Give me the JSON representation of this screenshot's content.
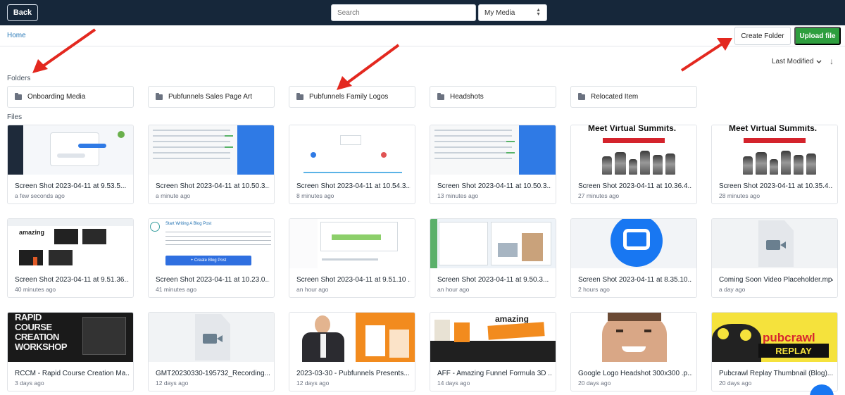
{
  "topbar": {
    "back_label": "Back",
    "search_placeholder": "Search",
    "media_select_value": "My Media"
  },
  "subheader": {
    "home_label": "Home",
    "create_folder_label": "Create Folder",
    "upload_label": "Upload file"
  },
  "sort": {
    "label": "Last Modified",
    "direction_icon": "↓"
  },
  "folders": {
    "label": "Folders",
    "items": [
      {
        "name": "Onboarding Media"
      },
      {
        "name": "Pubfunnels Sales Page Art"
      },
      {
        "name": "Pubfunnels Family Logos"
      },
      {
        "name": "Headshots"
      },
      {
        "name": "Relocated Item"
      }
    ]
  },
  "files": {
    "label": "Files",
    "items": [
      {
        "name": "Screen Shot 2023-04-11 at 9.53.5...",
        "time": "a few seconds ago"
      },
      {
        "name": "Screen Shot 2023-04-11 at 10.50.3...",
        "time": "a minute ago"
      },
      {
        "name": "Screen Shot 2023-04-11 at 10.54.3...",
        "time": "8 minutes ago"
      },
      {
        "name": "Screen Shot 2023-04-11 at 10.50.3...",
        "time": "13 minutes ago"
      },
      {
        "name": "Screen Shot 2023-04-11 at 10.36.4...",
        "time": "27 minutes ago"
      },
      {
        "name": "Screen Shot 2023-04-11 at 10.35.4...",
        "time": "28 minutes ago"
      },
      {
        "name": "Screen Shot 2023-04-11 at 9.51.36...",
        "time": "40 minutes ago"
      },
      {
        "name": "Screen Shot 2023-04-11 at 10.23.0...",
        "time": "41 minutes ago"
      },
      {
        "name": "Screen Shot 2023-04-11 at 9.51.10 ...",
        "time": "an hour ago"
      },
      {
        "name": "Screen Shot 2023-04-11 at 9.50.3...",
        "time": "an hour ago"
      },
      {
        "name": "Screen Shot 2023-04-11 at 8.35.10...",
        "time": "2 hours ago"
      },
      {
        "name": "Coming Soon Video Placeholder.mp4",
        "time": "a day ago"
      },
      {
        "name": "RCCM - Rapid Course Creation Ma...",
        "time": "3 days ago"
      },
      {
        "name": "GMT20230330-195732_Recording...",
        "time": "12 days ago"
      },
      {
        "name": "2023-03-30 - Pubfunnels Presents...",
        "time": "12 days ago"
      },
      {
        "name": "AFF - Amazing Funnel Formula 3D ...",
        "time": "14 days ago"
      },
      {
        "name": "Google Logo Headshot 300x300 .p...",
        "time": "20 days ago"
      },
      {
        "name": "Pubcrawl Replay Thumbnail (Blog)....",
        "time": "20 days ago"
      }
    ]
  },
  "thumb_text": {
    "summit": "Meet Virtual Summits.",
    "blog_title": "Start Writing A Blog Post",
    "blog_button": "+ Create Blog Post",
    "amazing": "amazing",
    "rccm": "RAPID COURSE CREATION WORKSHOP",
    "pubcrawl": "pubcrawl",
    "replay": "REPLAY"
  },
  "colors": {
    "topbar": "#16273a",
    "link": "#2a7ab8",
    "upload_button": "#2e9e3e",
    "annotation_arrow": "#e3281f"
  }
}
